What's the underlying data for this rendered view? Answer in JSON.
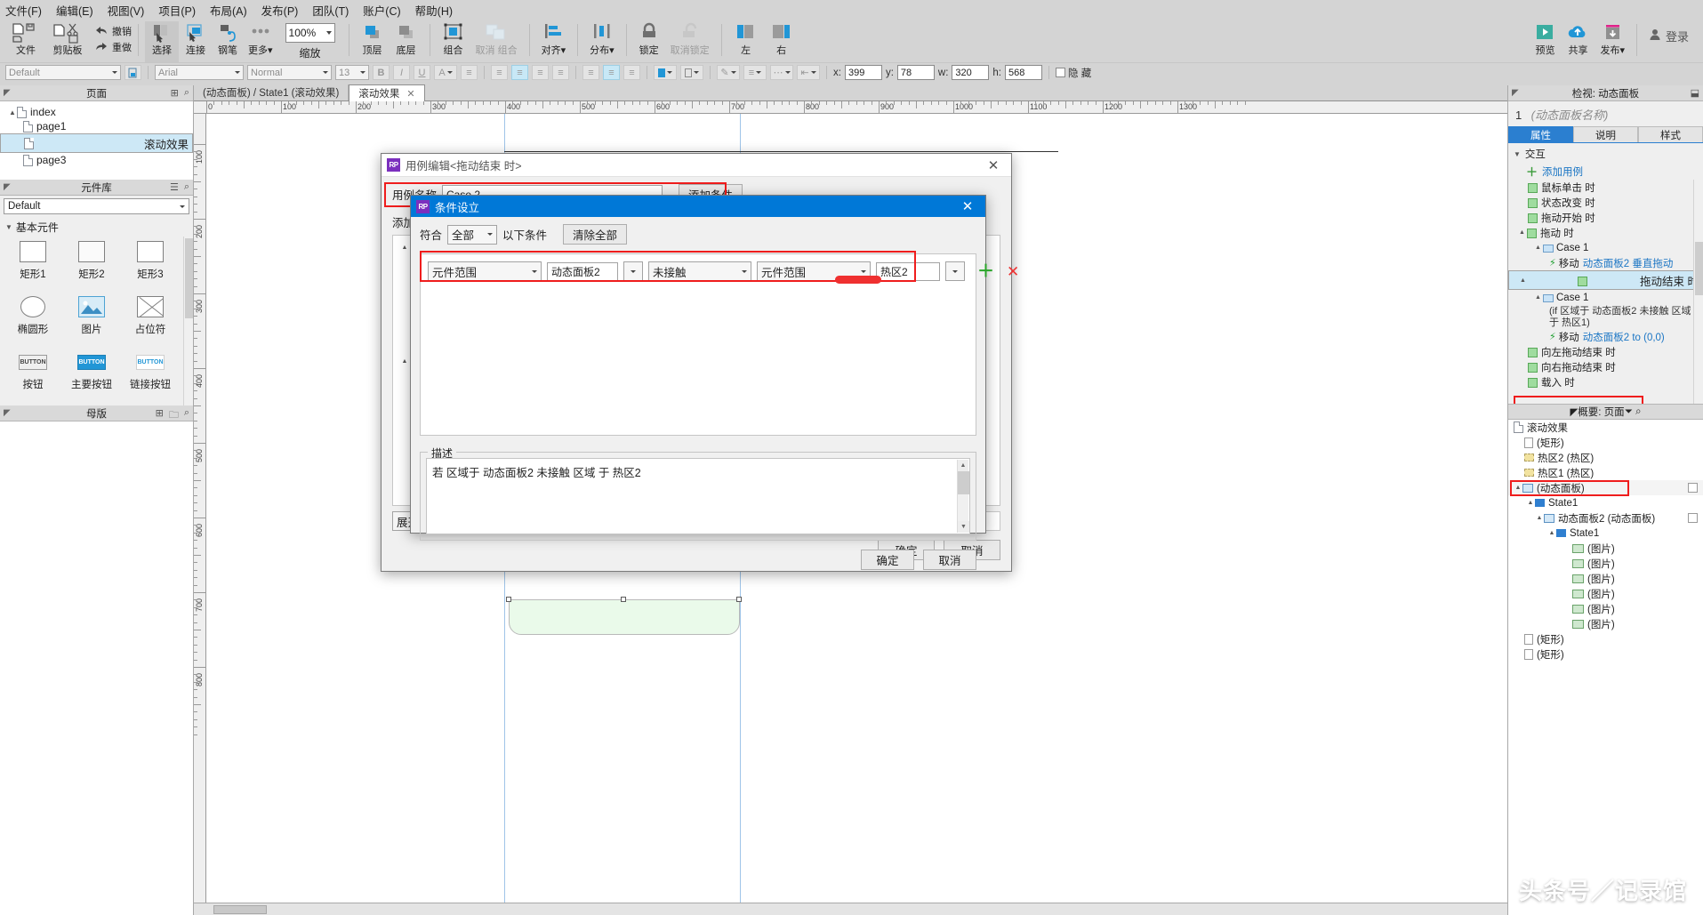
{
  "menubar": [
    {
      "label": "文件(F)"
    },
    {
      "label": "编辑(E)"
    },
    {
      "label": "视图(V)"
    },
    {
      "label": "项目(P)"
    },
    {
      "label": "布局(A)"
    },
    {
      "label": "发布(P)"
    },
    {
      "label": "团队(T)"
    },
    {
      "label": "账户(C)"
    },
    {
      "label": "帮助(H)"
    }
  ],
  "toolbar": {
    "file_label": "文件",
    "clipboard_label": "剪贴板",
    "undo_label": "撤销",
    "redo_label": "重做",
    "select_label": "选择",
    "connect_label": "连接",
    "pen_label": "钢笔",
    "more_label": "更多",
    "zoom_value": "100%",
    "zoom_label": "缩放",
    "top_label": "顶层",
    "bottom_label": "底层",
    "group_label": "组合",
    "ungroup_label": "取消 组合",
    "align_label": "对齐",
    "distribute_label": "分布",
    "lock_label": "锁定",
    "unlock_label": "取消锁定",
    "left_label": "左",
    "right_label": "右",
    "preview_label": "预览",
    "share_label": "共享",
    "publish_label": "发布",
    "login_label": "登录"
  },
  "formatbar": {
    "style_value": "Default",
    "font_value": "Arial",
    "weight_value": "Normal",
    "size_value": "13",
    "bold": "B",
    "italic": "I",
    "underline": "U",
    "color": "A",
    "x_label": "x:",
    "x_value": "399",
    "y_label": "y:",
    "y_value": "78",
    "w_label": "w:",
    "w_value": "320",
    "h_label": "h:",
    "h_value": "568",
    "hidden_label": "隐 藏"
  },
  "pages_panel": {
    "title": "页面",
    "items": [
      {
        "label": "index",
        "type": "page",
        "indent": 0,
        "selected": false,
        "expander": "▲"
      },
      {
        "label": "page1",
        "type": "page",
        "indent": 1,
        "selected": false,
        "expander": ""
      },
      {
        "label": "滚动效果",
        "type": "page",
        "indent": 1,
        "selected": true,
        "expander": ""
      },
      {
        "label": "page3",
        "type": "page",
        "indent": 1,
        "selected": false,
        "expander": ""
      }
    ]
  },
  "widgets_panel": {
    "title": "元件库",
    "library_value": "Default",
    "group_label": "基本元件",
    "items": [
      {
        "label": "矩形1",
        "icon": "rect1-icon"
      },
      {
        "label": "矩形2",
        "icon": "rect2-icon"
      },
      {
        "label": "矩形3",
        "icon": "rect3-icon"
      },
      {
        "label": "椭圆形",
        "icon": "ellipse-icon"
      },
      {
        "label": "图片",
        "icon": "image-icon"
      },
      {
        "label": "占位符",
        "icon": "placeholder-icon"
      },
      {
        "label": "按钮",
        "icon": "button-icon",
        "glyph": "BUTTON"
      },
      {
        "label": "主要按钮",
        "icon": "primary-button-icon",
        "glyph": "BUTTON"
      },
      {
        "label": "链接按钮",
        "icon": "link-button-icon",
        "glyph": "BUTTON"
      }
    ]
  },
  "masters_panel": {
    "title": "母版"
  },
  "canvas": {
    "tabs": [
      {
        "label": "(动态面板) / State1 (滚动效果)",
        "active": false,
        "closable": false
      },
      {
        "label": "滚动效果",
        "active": true,
        "closable": true
      }
    ],
    "ruler_h_labels": [
      "0",
      "100",
      "200",
      "300",
      "400",
      "500",
      "600",
      "700",
      "800",
      "900",
      "1000",
      "1100",
      "1200",
      "1300"
    ],
    "ruler_v_labels": [
      "100",
      "200",
      "300",
      "400",
      "500",
      "600",
      "700",
      "800"
    ]
  },
  "inspector": {
    "header": "检视: 动态面板",
    "index": "1",
    "name_placeholder": "(动态面板名称)",
    "tabs": [
      {
        "label": "属性",
        "active": true
      },
      {
        "label": "说明",
        "active": false
      },
      {
        "label": "样式",
        "active": false
      }
    ],
    "section_label": "交互",
    "add_case_label": "添加用例",
    "events": [
      {
        "label": "鼠标单击 时",
        "indent": 1,
        "type": "event",
        "selected": false
      },
      {
        "label": "状态改变 时",
        "indent": 1,
        "type": "event",
        "selected": false
      },
      {
        "label": "拖动开始 时",
        "indent": 1,
        "type": "event",
        "selected": false
      },
      {
        "label": "拖动 时",
        "indent": 1,
        "type": "event-open",
        "selected": false
      },
      {
        "label": "Case 1",
        "indent": 2,
        "type": "case",
        "selected": false
      },
      {
        "label": "移动",
        "indent": 3,
        "type": "action",
        "selected": false,
        "detail": "动态面板2 垂直拖动"
      },
      {
        "label": "拖动结束 时",
        "indent": 1,
        "type": "event-open",
        "selected": true
      },
      {
        "label": "Case 1",
        "indent": 2,
        "type": "case",
        "selected": false
      },
      {
        "label": "(if 区域于 动态面板2 未接触 区域",
        "indent": 3,
        "type": "cond",
        "selected": false
      },
      {
        "label": "于 热区1)",
        "indent": 3,
        "type": "cond",
        "selected": false
      },
      {
        "label": "移动",
        "indent": 3,
        "type": "action",
        "selected": false,
        "detail": "动态面板2 to (0,0)"
      },
      {
        "label": "向左拖动结束 时",
        "indent": 1,
        "type": "event",
        "selected": false
      },
      {
        "label": "向右拖动结束 时",
        "indent": 1,
        "type": "event",
        "selected": false
      },
      {
        "label": "载入 时",
        "indent": 1,
        "type": "event",
        "selected": false
      }
    ]
  },
  "outline": {
    "header": "概要: 页面",
    "root": "滚动效果",
    "items": [
      {
        "label": "(矩形)",
        "indent": 1,
        "icon": "rect-icon",
        "expander": ""
      },
      {
        "label": "热区2 (热区)",
        "indent": 1,
        "icon": "hotspot-icon",
        "expander": ""
      },
      {
        "label": "热区1 (热区)",
        "indent": 1,
        "icon": "hotspot-icon",
        "expander": ""
      },
      {
        "label": "(动态面板)",
        "indent": 1,
        "icon": "dynamic-panel-icon",
        "expander": "▲",
        "selected": true
      },
      {
        "label": "State1",
        "indent": 2,
        "icon": "state-icon",
        "expander": "▲"
      },
      {
        "label": "动态面板2 (动态面板)",
        "indent": 3,
        "icon": "dynamic-panel-icon",
        "expander": "▲"
      },
      {
        "label": "State1",
        "indent": 4,
        "icon": "state-icon",
        "expander": "▲"
      },
      {
        "label": "(图片)",
        "indent": 5,
        "icon": "image-icon",
        "expander": ""
      },
      {
        "label": "(图片)",
        "indent": 5,
        "icon": "image-icon",
        "expander": ""
      },
      {
        "label": "(图片)",
        "indent": 5,
        "icon": "image-icon",
        "expander": ""
      },
      {
        "label": "(图片)",
        "indent": 5,
        "icon": "image-icon",
        "expander": ""
      },
      {
        "label": "(图片)",
        "indent": 5,
        "icon": "image-icon",
        "expander": ""
      },
      {
        "label": "(图片)",
        "indent": 5,
        "icon": "image-icon",
        "expander": ""
      },
      {
        "label": "(矩形)",
        "indent": 1,
        "icon": "rect-icon",
        "expander": ""
      },
      {
        "label": "(矩形)",
        "indent": 1,
        "icon": "rect-icon",
        "expander": ""
      }
    ]
  },
  "case_editor_dialog": {
    "title": "用例编辑<拖动结束 时>",
    "case_name_label": "用例名称",
    "case_name_value": "Case 2",
    "add_condition_button": "添加条件",
    "add_action_label": "添加动作",
    "tree_footer": "展开/折叠树节点",
    "ok_button": "确定",
    "cancel_button": "取消"
  },
  "condition_dialog": {
    "title": "条件设立",
    "match_label": "符合",
    "match_value": "全部",
    "suffix_label": "以下条件",
    "clear_all_button": "清除全部",
    "condition_row": {
      "field1": "元件范围",
      "field2": "动态面板2",
      "field3": "未接触",
      "field4": "元件范围",
      "field5": "热区2"
    },
    "add_row_icon": "plus-icon",
    "remove_row_icon": "delete-icon",
    "description_legend": "描述",
    "description_text": "若 区域于 动态面板2 未接触 区域 于 热区2",
    "ok_button": "确定",
    "cancel_button": "取消"
  },
  "watermark": "头条号／记录馆",
  "colors": {
    "accent_blue": "#0078d7",
    "axure_purple": "#7b2fbe",
    "highlight_red": "#ef1d1d",
    "teal": "#3aada0",
    "magenta": "#e0218a"
  }
}
